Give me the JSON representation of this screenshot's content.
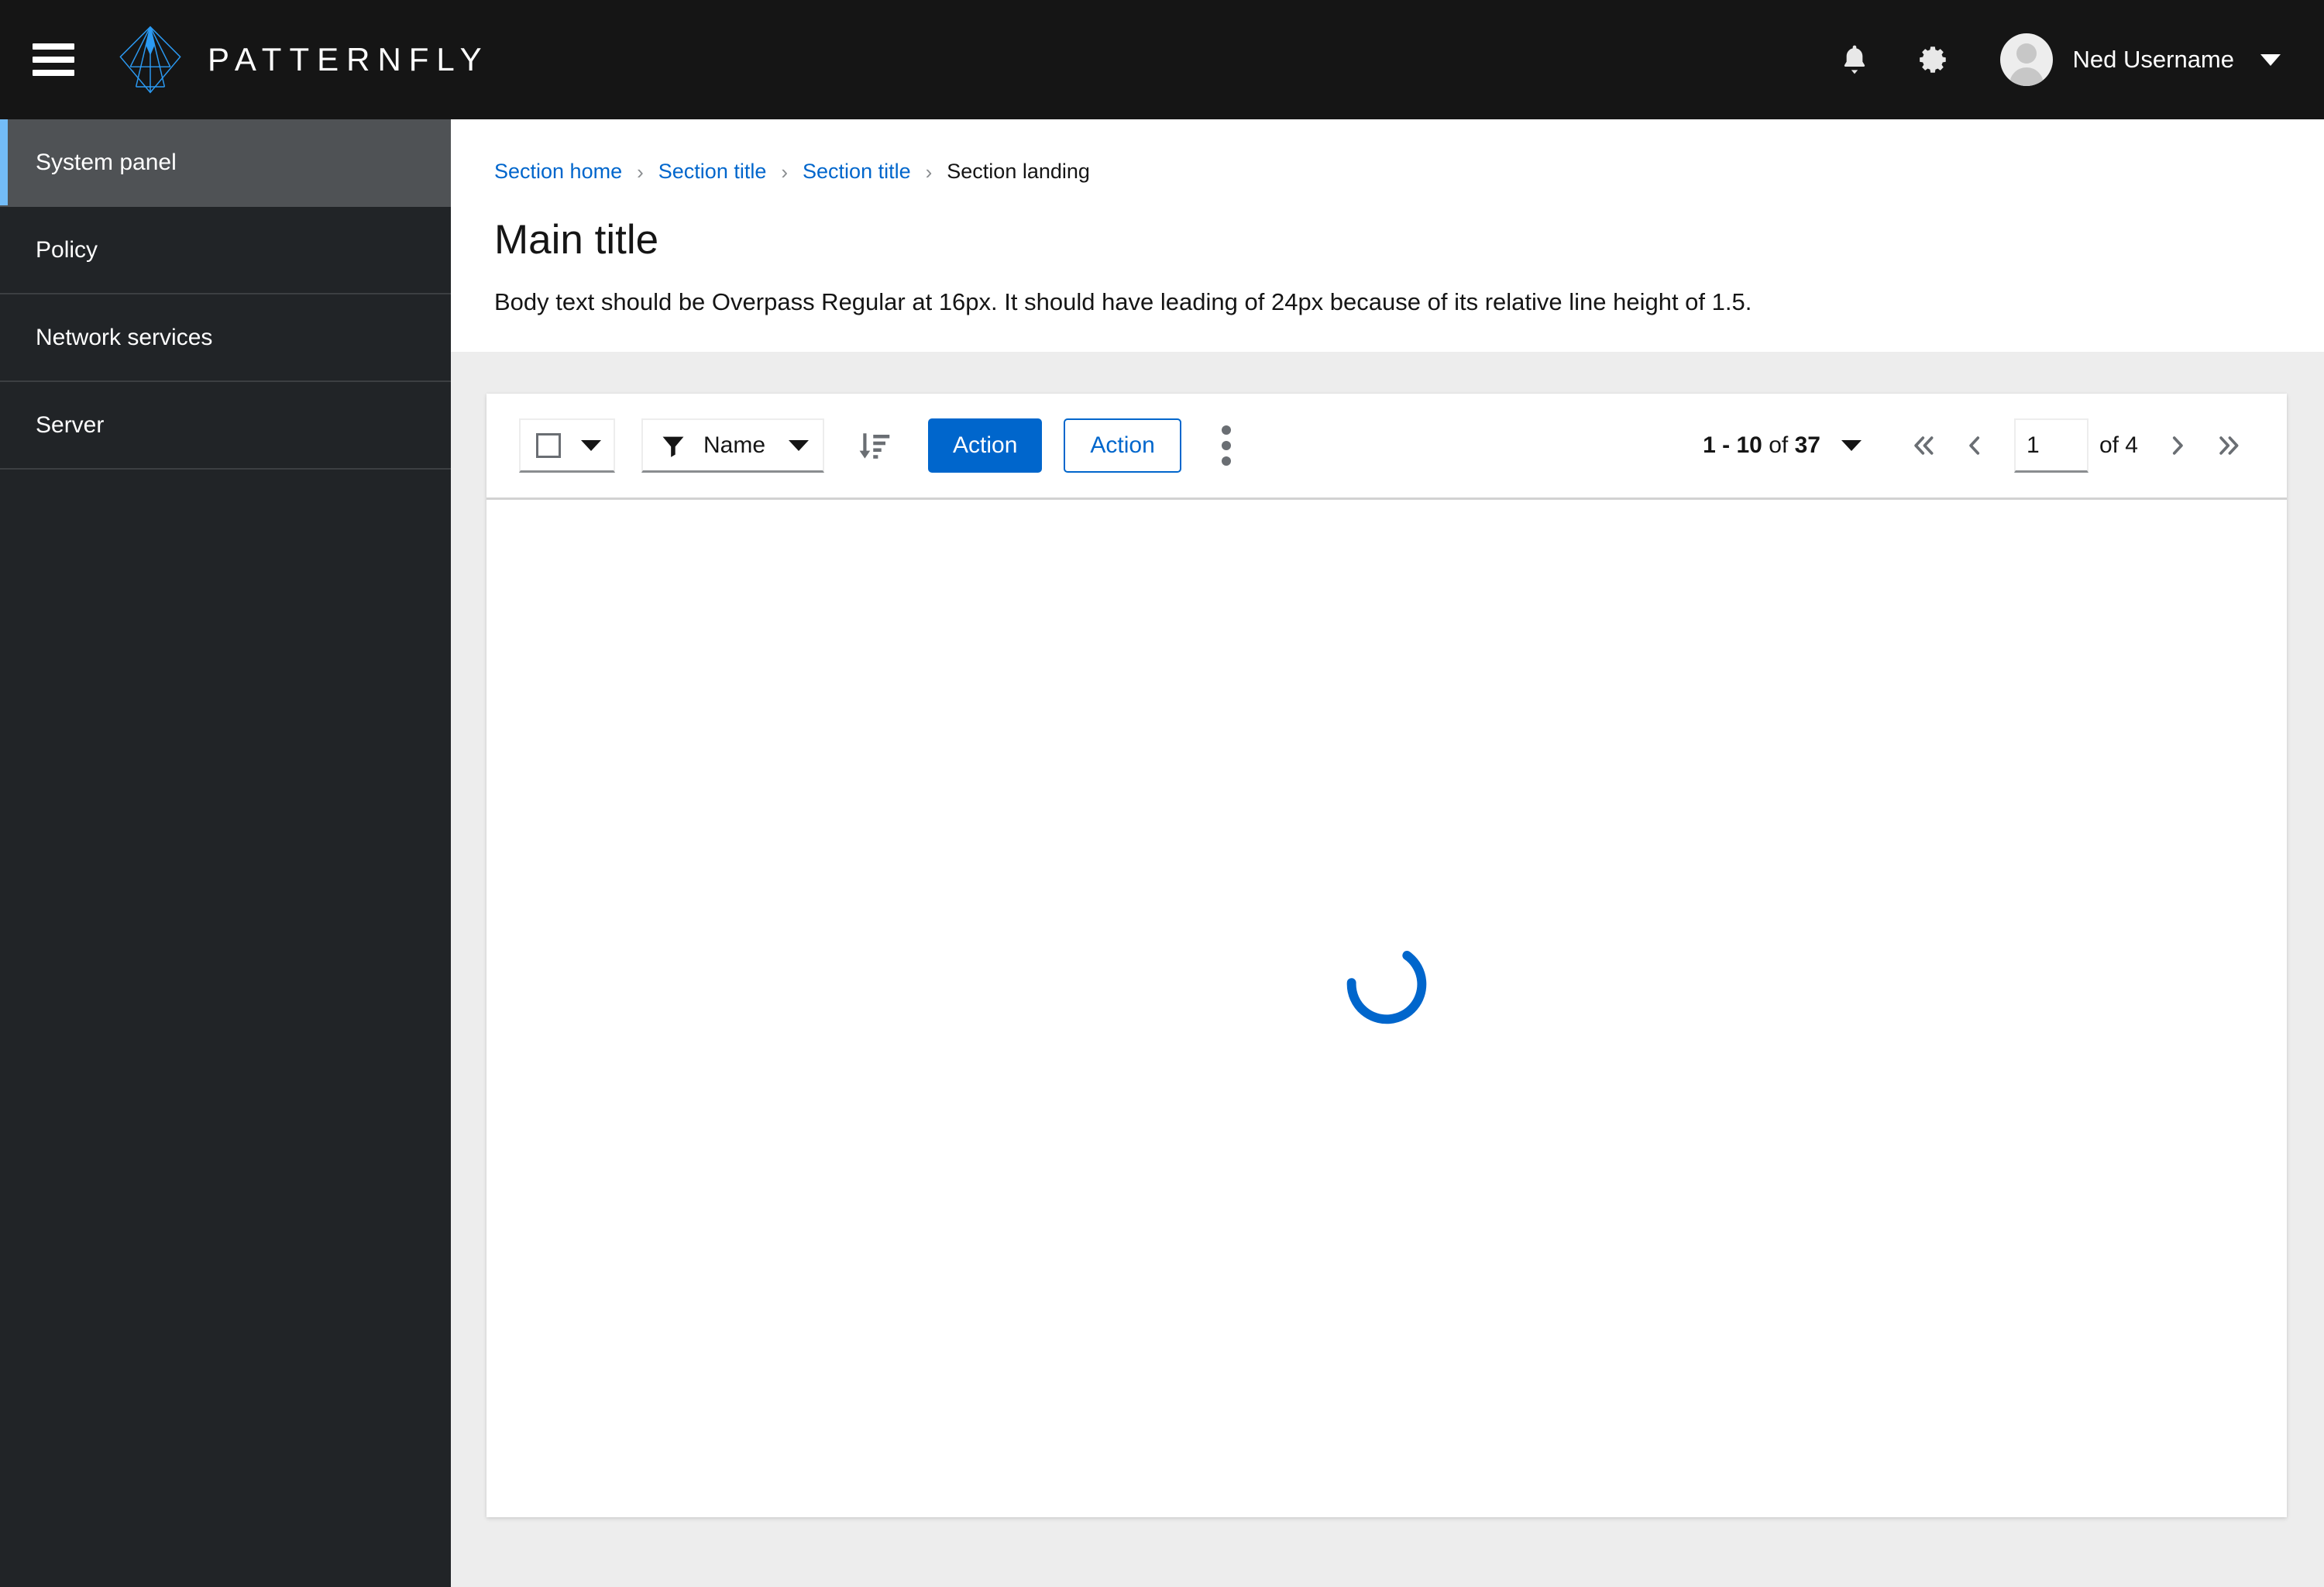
{
  "masthead": {
    "menu_toggle_label": "Global navigation",
    "brand_name": "PATTERNFLY",
    "notifications_label": "Notifications",
    "settings_label": "Settings",
    "user_name": "Ned Username"
  },
  "sidebar": {
    "items": [
      {
        "label": "System panel",
        "active": true
      },
      {
        "label": "Policy",
        "active": false
      },
      {
        "label": "Network services",
        "active": false
      },
      {
        "label": "Server",
        "active": false
      }
    ]
  },
  "breadcrumb": {
    "separator": "›",
    "items": [
      {
        "label": "Section home",
        "current": false
      },
      {
        "label": "Section title",
        "current": false
      },
      {
        "label": "Section title",
        "current": false
      },
      {
        "label": "Section landing",
        "current": true
      }
    ]
  },
  "page": {
    "title": "Main title",
    "body": "Body text should be Overpass Regular at 16px. It should have leading of 24px because of its relative line height of 1.5."
  },
  "toolbar": {
    "bulk_select_label": "Select all",
    "filter_label": "Name",
    "sort_label": "Sort",
    "primary_action_label": "Action",
    "secondary_action_label": "Action",
    "kebab_label": "More actions"
  },
  "pagination": {
    "range": "1 - 10",
    "of_word": "of",
    "total": "37",
    "per_page_label": "Items per page",
    "first_label": "Go to first page",
    "prev_label": "Go to previous page",
    "next_label": "Go to next page",
    "last_label": "Go to last page",
    "current_page": "1",
    "page_count_label": "of 4"
  },
  "content": {
    "loading_label": "Loading"
  },
  "colors": {
    "masthead_bg": "#151515",
    "sidebar_bg": "#212427",
    "sidebar_active_bg": "#4f5255",
    "accent_blue": "#0066cc",
    "active_indicator": "#73bcf7",
    "link_blue": "#0066cc",
    "page_bg": "#ededed",
    "brand_blue": "#2b9af3"
  }
}
